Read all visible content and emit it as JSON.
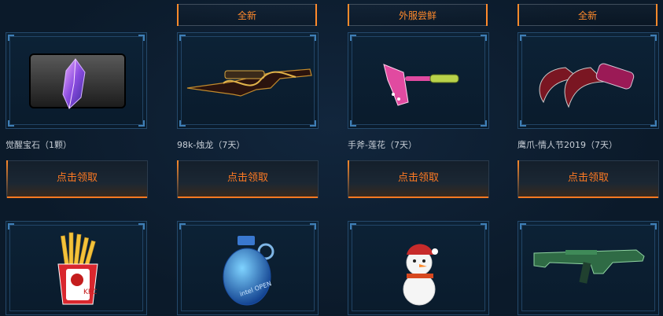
{
  "badges": [
    "全新",
    "外服尝鲜",
    "全新"
  ],
  "items": [
    {
      "name": "觉醒宝石（1颗）",
      "button": "点击领取"
    },
    {
      "name": "98k-烛龙（7天）",
      "button": "点击领取"
    },
    {
      "name": "手斧-莲花（7天）",
      "button": "点击领取"
    },
    {
      "name": "鹰爪-情人节2019（7天）",
      "button": "点击领取"
    }
  ],
  "row2": [
    {
      "icon": "fries-icon",
      "text": "KFC"
    },
    {
      "icon": "grenade-icon",
      "text": "intel OPEN"
    },
    {
      "icon": "snowman-icon"
    },
    {
      "icon": "smg-icon"
    }
  ],
  "colors": {
    "accent": "#ff7a22",
    "frame": "#24496b",
    "background": "#0b1a2a"
  }
}
